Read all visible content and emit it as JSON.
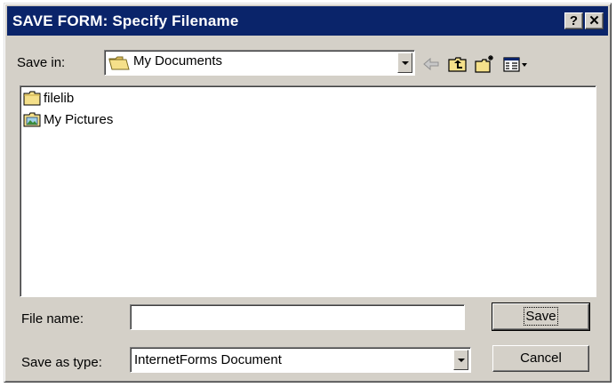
{
  "window": {
    "title": "SAVE FORM: Specify Filename",
    "help_label": "?",
    "close_label": "✕"
  },
  "toolbar": {
    "save_in_label": "Save in:",
    "save_in_value": "My Documents",
    "icons": [
      "folder-icon",
      "back-arrow-icon",
      "up-one-level-icon",
      "new-folder-icon",
      "view-menu-icon"
    ]
  },
  "files": [
    {
      "name": "filelib",
      "icon": "folder-icon"
    },
    {
      "name": "My Pictures",
      "icon": "pictures-folder-icon"
    }
  ],
  "form": {
    "file_name_label": "File name:",
    "file_name_value": "",
    "save_as_type_label": "Save as type:",
    "save_as_type_value": "InternetForms Document"
  },
  "buttons": {
    "save_label": "Save",
    "cancel_label": "Cancel"
  },
  "colors": {
    "titlebar": "#0a246a",
    "face": "#d4d0c8"
  }
}
